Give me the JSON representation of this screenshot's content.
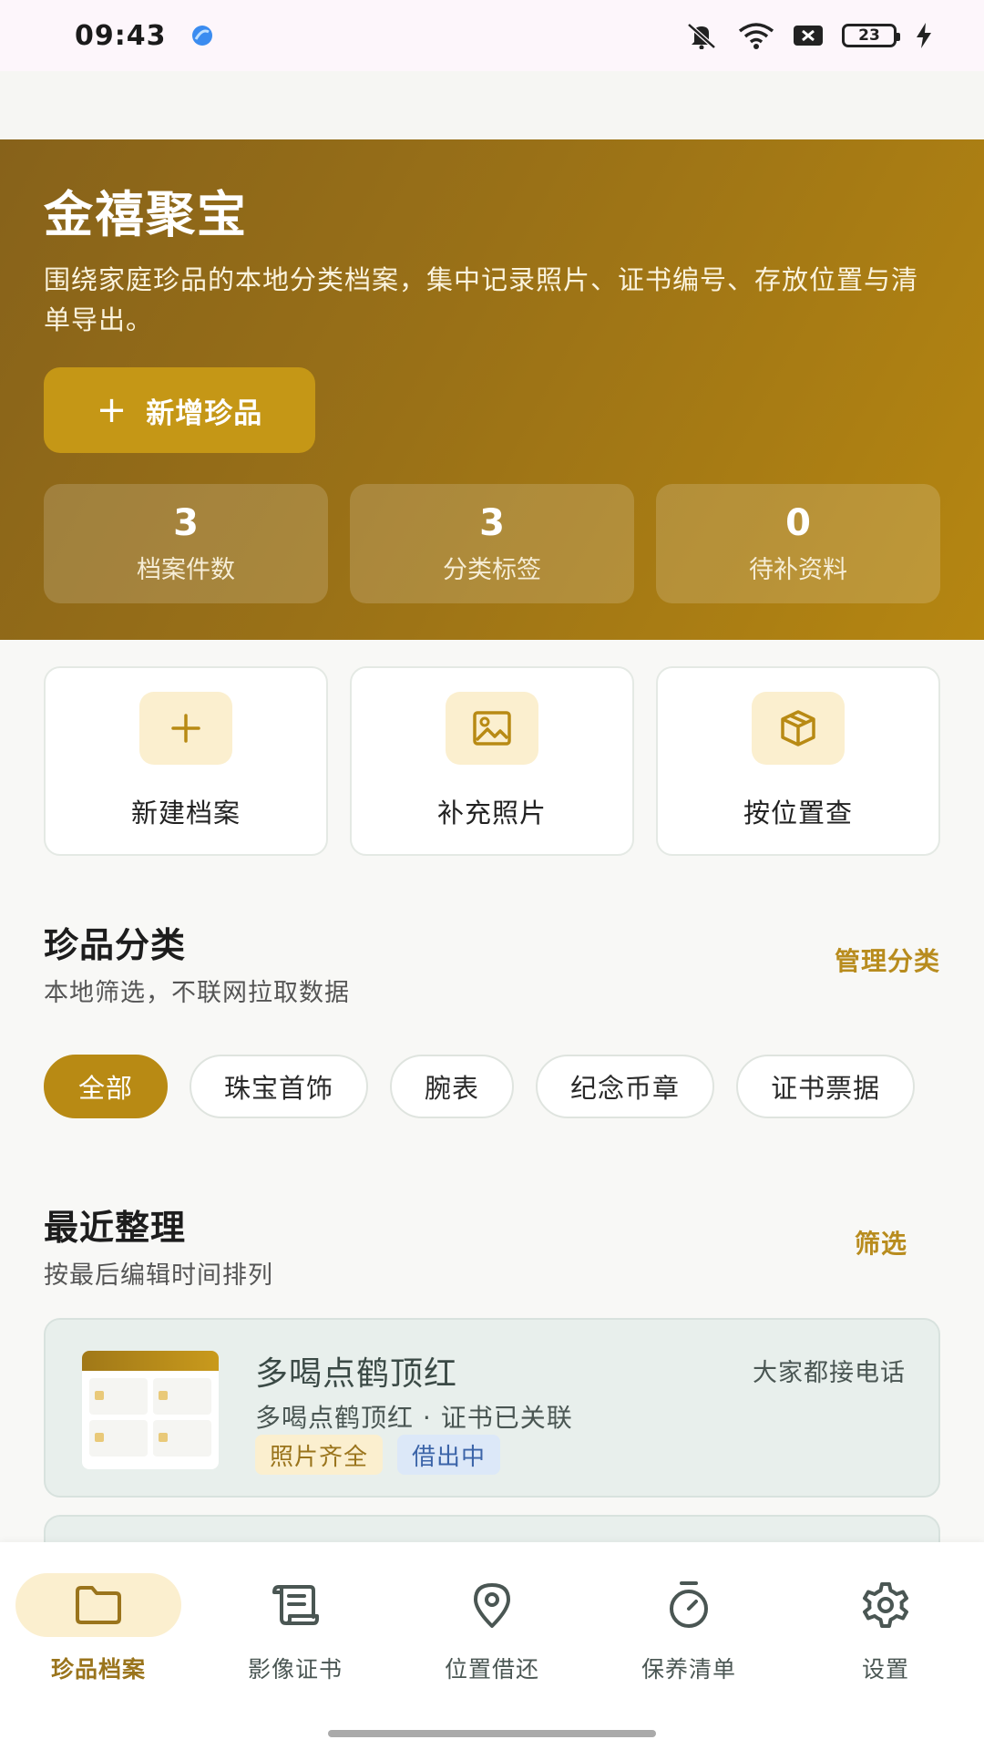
{
  "status_bar": {
    "time": "09:43",
    "battery": "23",
    "icons": [
      "mute-icon",
      "wifi-icon",
      "close-box-icon",
      "battery-icon",
      "charging-icon"
    ]
  },
  "hero": {
    "title": "金禧聚宝",
    "description": "围绕家庭珍品的本地分类档案，集中记录照片、证书编号、存放位置与清单导出。",
    "add_button": "新增珍品",
    "stats": [
      {
        "value": "3",
        "label": "档案件数"
      },
      {
        "value": "3",
        "label": "分类标签"
      },
      {
        "value": "0",
        "label": "待补资料"
      }
    ]
  },
  "quick_actions": [
    {
      "label": "新建档案",
      "icon": "plus-icon"
    },
    {
      "label": "补充照片",
      "icon": "image-icon"
    },
    {
      "label": "按位置查",
      "icon": "box-icon"
    }
  ],
  "categories": {
    "title": "珍品分类",
    "subtitle": "本地筛选，不联网拉取数据",
    "action": "管理分类",
    "chips": [
      "全部",
      "珠宝首饰",
      "腕表",
      "纪念币章",
      "证书票据"
    ],
    "active_index": 0
  },
  "recent": {
    "title": "最近整理",
    "subtitle": "按最后编辑时间排列",
    "action": "筛选",
    "items": [
      {
        "title": "多喝点鹤顶红",
        "owner": "大家都接电话",
        "subtitle": "多喝点鹤顶红 · 证书已关联",
        "tags": [
          "照片齐全",
          "借出中"
        ]
      }
    ]
  },
  "bottom_nav": [
    {
      "label": "珍品档案",
      "icon": "folder-icon",
      "active": true
    },
    {
      "label": "影像证书",
      "icon": "scroll-icon",
      "active": false
    },
    {
      "label": "位置借还",
      "icon": "location-pin-icon",
      "active": false
    },
    {
      "label": "保养清单",
      "icon": "timer-icon",
      "active": false
    },
    {
      "label": "设置",
      "icon": "gear-icon",
      "active": false
    }
  ],
  "colors": {
    "accent": "#b88a14",
    "hero_start": "#87621a",
    "hero_end": "#b58611",
    "tag_gold_bg": "#fbefcf",
    "tag_blue_bg": "#dce8f8"
  }
}
